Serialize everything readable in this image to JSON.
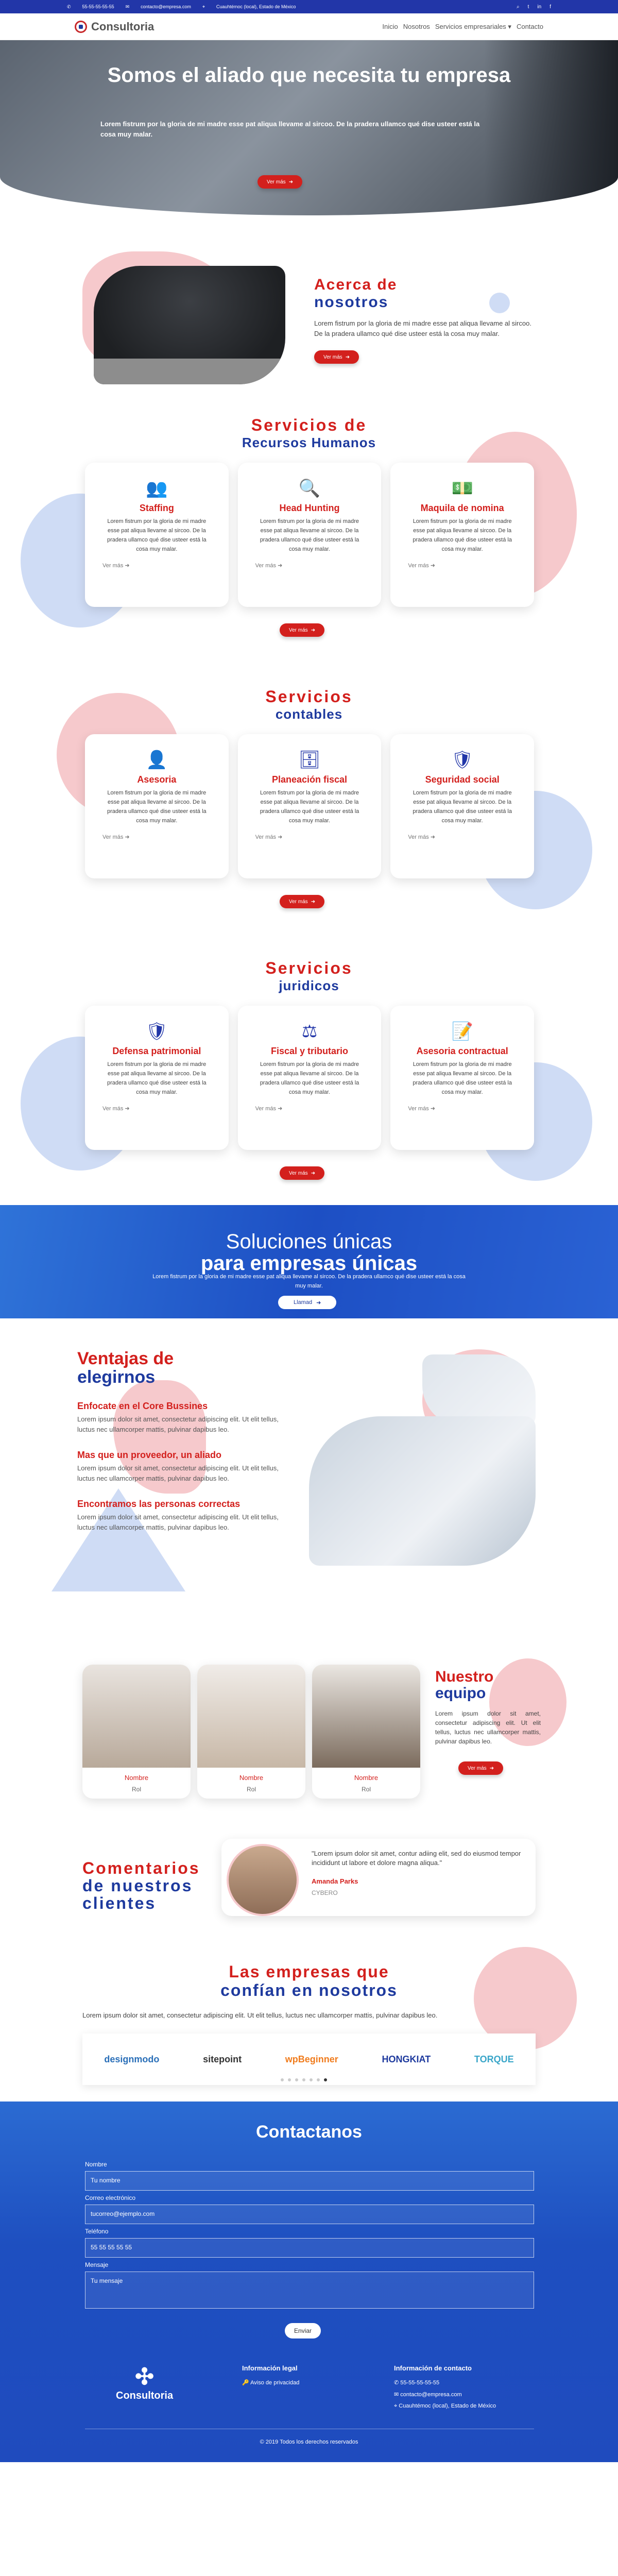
{
  "topbar": {
    "phone": "55-55-55-55-55",
    "email": "contacto@empresa.com",
    "address": "Cuauhtémoc (local), Estado de México",
    "social": [
      "search-icon",
      "twitter-icon",
      "linkedin-icon",
      "facebook-icon"
    ]
  },
  "nav": {
    "brand": "Consultoria",
    "links": [
      "Inicio",
      "Nosotros",
      "Servicios empresariales ▾",
      "Contacto"
    ]
  },
  "hero": {
    "title": "Somos el aliado que necesita tu empresa",
    "text": "Lorem fistrum por la gloria de mi madre esse pat aliqua llevame al sircoo. De la pradera ullamco qué dise usteer está la cosa muy malar.",
    "button": "Ver más"
  },
  "about": {
    "title_l1": "Acerca de",
    "title_l2": "nosotros",
    "text": "Lorem fistrum por la gloria de mi madre esse pat aliqua llevame al sircoo. De la pradera ullamco qué dise usteer está la cosa muy malar.",
    "button": "Ver más"
  },
  "services": [
    {
      "title1": "Servicios de",
      "title2": "Recursos Humanos",
      "cards": [
        {
          "icon": "users-icon",
          "glyph": "👥",
          "title": "Staffing"
        },
        {
          "icon": "search-icon",
          "glyph": "🔍",
          "title": "Head Hunting"
        },
        {
          "icon": "money-icon",
          "glyph": "💵",
          "title": "Maquila de nomina"
        }
      ]
    },
    {
      "title1": "Servicios",
      "title2": "contables",
      "cards": [
        {
          "icon": "user-tie-icon",
          "glyph": "👤",
          "title": "Asesoria"
        },
        {
          "icon": "archive-icon",
          "glyph": "🗄",
          "title": "Planeación fiscal"
        },
        {
          "icon": "user-shield-icon",
          "glyph": "🛡",
          "title": "Seguridad social"
        }
      ]
    },
    {
      "title1": "Servicios",
      "title2": "juridicos",
      "cards": [
        {
          "icon": "user-shield-icon",
          "glyph": "🛡",
          "title": "Defensa patrimonial"
        },
        {
          "icon": "scale-icon",
          "glyph": "⚖",
          "title": "Fiscal y tributario"
        },
        {
          "icon": "contract-icon",
          "glyph": "📝",
          "title": "Asesoria contractual"
        }
      ]
    }
  ],
  "card_text": "Lorem fistrum por la gloria de mi madre esse pat aliqua llevame al sircoo. De la pradera ullamco qué dise usteer está la cosa muy malar.",
  "card_more": "Ver más",
  "section_button": "Ver más",
  "banner": {
    "title1": "Soluciones únicas",
    "title2": "para empresas únicas",
    "text": "Lorem fistrum por la gloria de mi madre esse pat aliqua llevame al sircoo. De la pradera ullamco qué dise usteer está la cosa muy malar.",
    "button": "Llamad"
  },
  "advantages": {
    "title_l1": "Ventajas de",
    "title_l2": "elegirnos",
    "items": [
      {
        "title": "Enfocate en el Core Bussines",
        "text": "Lorem ipsum dolor sit amet, consectetur adipiscing elit. Ut elit tellus, luctus nec ullamcorper mattis, pulvinar dapibus leo."
      },
      {
        "title": "Mas que un proveedor, un aliado",
        "text": "Lorem ipsum dolor sit amet, consectetur adipiscing elit. Ut elit tellus, luctus nec ullamcorper mattis, pulvinar dapibus leo."
      },
      {
        "title": "Encontramos las personas correctas",
        "text": "Lorem ipsum dolor sit amet, consectetur adipiscing elit. Ut elit tellus, luctus nec ullamcorper mattis, pulvinar dapibus leo."
      }
    ]
  },
  "team": {
    "title_l1": "Nuestro",
    "title_l2": "equipo",
    "text": "Lorem ipsum dolor sit amet, consectetur adipiscing elit. Ut elit tellus, luctus nec ullamcorper mattis, pulvinar dapibus leo.",
    "button": "Ver más",
    "members": [
      {
        "name": "Nombre",
        "role": "Rol"
      },
      {
        "name": "Nombre",
        "role": "Rol"
      },
      {
        "name": "Nombre",
        "role": "Rol"
      }
    ]
  },
  "testimonials": {
    "title_l1": "Comentarios",
    "title_l2": "de nuestros",
    "title_l3": "clientes",
    "quote": "\"Lorem ipsum dolor sit amet, contur adiing elit, sed do eiusmod tempor incididunt ut labore et dolore magna aliqua.\"",
    "author": "Amanda Parks",
    "company": "CYBERO"
  },
  "clients": {
    "title_l1": "Las empresas que",
    "title_l2": "confían en nosotros",
    "text": "Lorem ipsum dolor sit amet, consectetur adipiscing elit. Ut elit tellus, luctus nec ullamcorper mattis, pulvinar dapibus leo.",
    "logos": [
      {
        "name": "designmodo",
        "color": "#2a6fb8"
      },
      {
        "name": "sitepoint",
        "color": "#333333"
      },
      {
        "name": "wpBeginner",
        "color": "#f07c1d"
      },
      {
        "name": "HONGKIAT",
        "color": "#1e3a9e"
      },
      {
        "name": "TORQUE",
        "color": "#3aa6c9"
      }
    ]
  },
  "contact": {
    "title": "Contactanos",
    "fields": [
      {
        "label": "Nombre",
        "placeholder": "Tu nombre"
      },
      {
        "label": "Correo electrónico",
        "placeholder": "tucorreo@ejemplo.com"
      },
      {
        "label": "Teléfono",
        "placeholder": "55 55 55 55 55"
      },
      {
        "label": "Mensaje",
        "placeholder": "Tu mensaje"
      }
    ],
    "button": "Enviar"
  },
  "footer": {
    "brand": "Consultoria",
    "legal_title": "Información legal",
    "legal_item": "Aviso de privacidad",
    "info_title": "Información de contacto",
    "info_items": [
      "55-55-55-55-55",
      "contacto@empresa.com",
      "Cuauhtémoc (local), Estado de México"
    ],
    "copyright": "© 2019 Todos los derechos reservados"
  },
  "colors": {
    "primary_blue": "#2236a8",
    "accent_red": "#d3201d",
    "pink_blob": "#f6c9cc",
    "light_blue_blob": "#cfdcf5"
  }
}
